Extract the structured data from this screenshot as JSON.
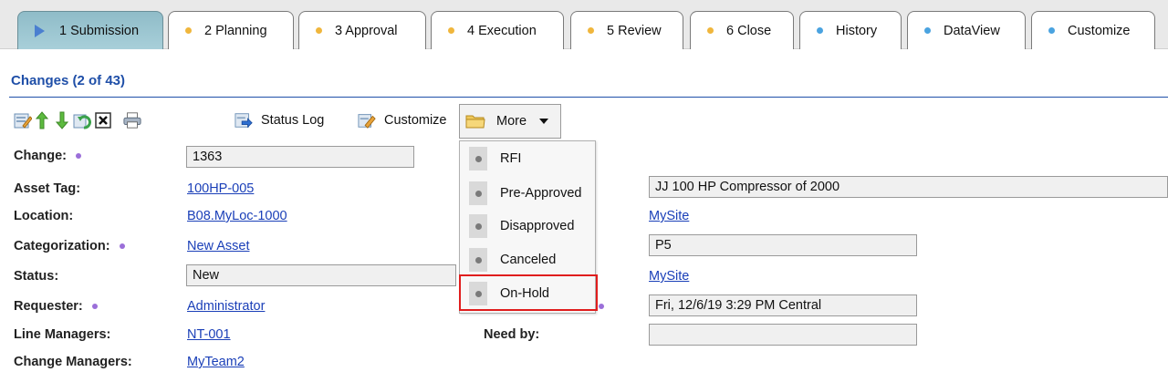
{
  "tabs": [
    {
      "label": "1 Submission",
      "active": true
    },
    {
      "label": "2 Planning"
    },
    {
      "label": "3 Approval"
    },
    {
      "label": "4 Execution"
    },
    {
      "label": "5 Review"
    },
    {
      "label": "6 Close"
    },
    {
      "label": "History"
    },
    {
      "label": "DataView"
    },
    {
      "label": "Customize"
    }
  ],
  "section": {
    "title": "Changes (2 of 43)"
  },
  "toolbar": {
    "status_log_label": "Status Log",
    "customize_label": "Customize",
    "more_label": "More"
  },
  "form": {
    "change_label": "Change:",
    "change_value": "1363",
    "asset_tag_label": "Asset Tag:",
    "asset_tag_value": "100HP-005",
    "asset_desc_value": "JJ 100 HP Compressor of 2000",
    "location_label": "Location:",
    "location_value": "B08.MyLoc-1000",
    "location_site_value": "MySite",
    "categorization_label": "Categorization:",
    "categorization_value": "New Asset",
    "priority_value": "P5",
    "status_label": "Status:",
    "status_value": "New",
    "status_site_value": "MySite",
    "requester_label": "Requester:",
    "requester_value": "Administrator",
    "requested_date_value": "Fri, 12/6/19 3:29 PM Central",
    "line_managers_label": "Line Managers:",
    "line_managers_value": "NT-001",
    "need_by_label": "Need by:",
    "need_by_value": "",
    "change_managers_label": "Change Managers:",
    "change_managers_value": "MyTeam2"
  },
  "more_menu": {
    "items": [
      "RFI",
      "Pre-Approved",
      "Disapproved",
      "Canceled",
      "On-Hold"
    ],
    "highlighted": "On-Hold"
  },
  "colors": {
    "tab_dot": "#f0b63c",
    "tab_dot_blue": "#4aa3e0",
    "link": "#1a3fb8",
    "title": "#1f4fa8",
    "highlight": "#e01d1d"
  }
}
